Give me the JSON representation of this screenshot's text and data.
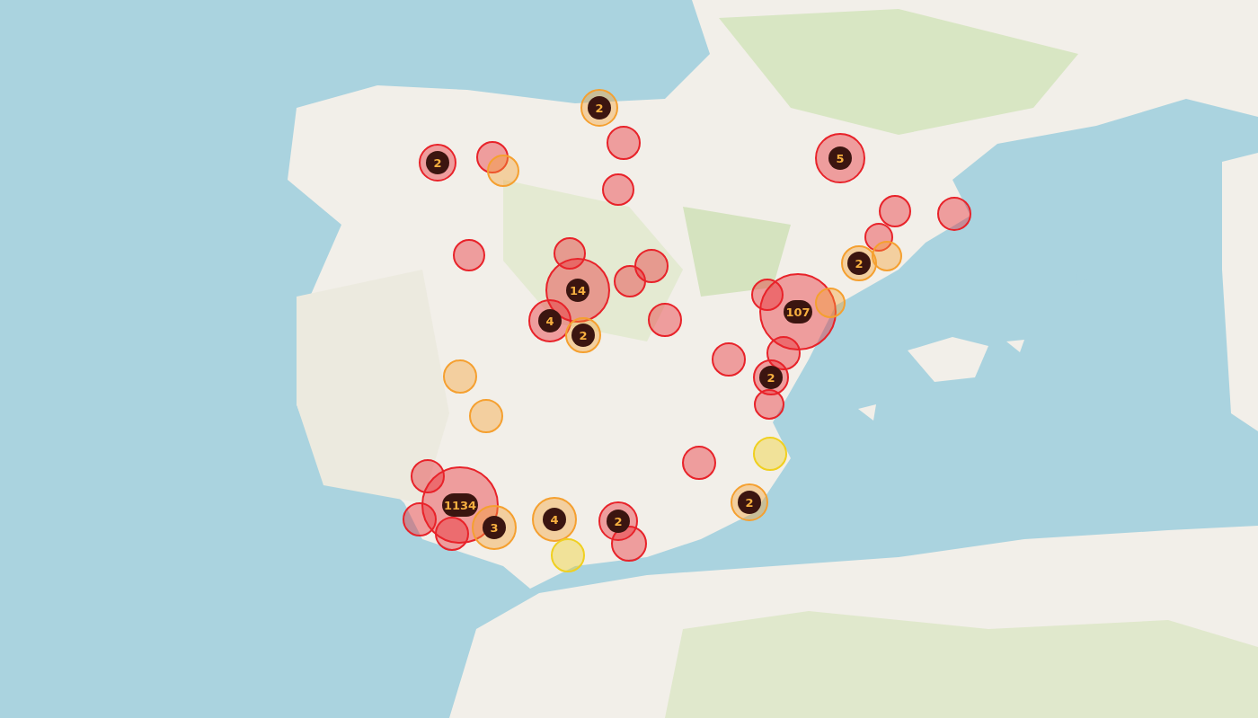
{
  "markers": [
    {
      "kind": "cluster",
      "color": "#f5a030",
      "count": "2"
    },
    {
      "kind": "cluster",
      "color": "#e8232a",
      "count": "2"
    },
    {
      "kind": "point",
      "color": "#e8232a"
    },
    {
      "kind": "point",
      "color": "#f5a030"
    },
    {
      "kind": "point",
      "color": "#e8232a"
    },
    {
      "kind": "point",
      "color": "#e8232a"
    },
    {
      "kind": "cluster",
      "color": "#e8232a",
      "count": "5"
    },
    {
      "kind": "point",
      "color": "#e8232a"
    },
    {
      "kind": "point",
      "color": "#e8232a"
    },
    {
      "kind": "point",
      "color": "#e8232a"
    },
    {
      "kind": "point",
      "color": "#f5a030"
    },
    {
      "kind": "cluster",
      "color": "#f5a030",
      "count": "2"
    },
    {
      "kind": "point",
      "color": "#e8232a"
    },
    {
      "kind": "point",
      "color": "#e8232a"
    },
    {
      "kind": "point",
      "color": "#e8232a"
    },
    {
      "kind": "point",
      "color": "#e8232a"
    },
    {
      "kind": "cluster",
      "color": "#e8232a",
      "count": "14"
    },
    {
      "kind": "cluster",
      "color": "#e8232a",
      "count": "4"
    },
    {
      "kind": "cluster",
      "color": "#f5a030",
      "count": "2"
    },
    {
      "kind": "point",
      "color": "#e8232a"
    },
    {
      "kind": "point",
      "color": "#e8232a"
    },
    {
      "kind": "point",
      "color": "#f5a030"
    },
    {
      "kind": "cluster",
      "color": "#e8232a",
      "count": "107"
    },
    {
      "kind": "point",
      "color": "#e8232a"
    },
    {
      "kind": "point",
      "color": "#e8232a"
    },
    {
      "kind": "cluster",
      "color": "#e8232a",
      "count": "2"
    },
    {
      "kind": "point",
      "color": "#e8232a"
    },
    {
      "kind": "point",
      "color": "#f5a030"
    },
    {
      "kind": "point",
      "color": "#f5a030"
    },
    {
      "kind": "point",
      "color": "#f0d020"
    },
    {
      "kind": "point",
      "color": "#e8232a"
    },
    {
      "kind": "cluster",
      "color": "#f5a030",
      "count": "2"
    },
    {
      "kind": "point",
      "color": "#e8232a"
    },
    {
      "kind": "point",
      "color": "#e8232a"
    },
    {
      "kind": "point",
      "color": "#e8232a"
    },
    {
      "kind": "cluster",
      "color": "#e8232a",
      "count": "1134"
    },
    {
      "kind": "cluster",
      "color": "#f5a030",
      "count": "3"
    },
    {
      "kind": "cluster",
      "color": "#f5a030",
      "count": "4"
    },
    {
      "kind": "point",
      "color": "#f0d020"
    },
    {
      "kind": "point",
      "color": "#e8232a"
    },
    {
      "kind": "cluster",
      "color": "#e8232a",
      "count": "2"
    }
  ]
}
